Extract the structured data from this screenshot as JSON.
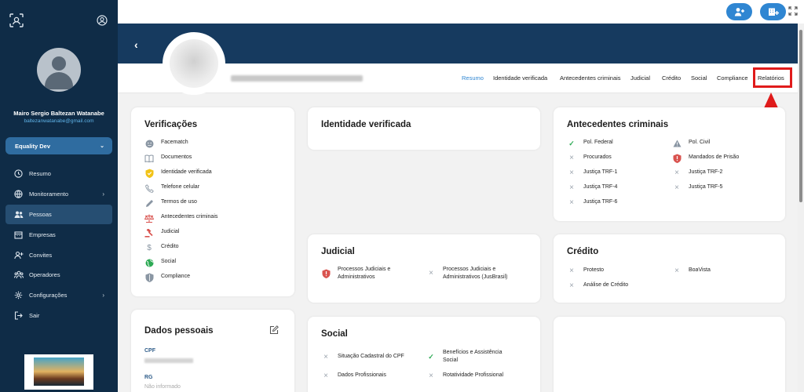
{
  "sidebar": {
    "user_name": "Mairo Sergio Baltezan Watanabe",
    "user_email": "baltezanwatanabe@gmail.com",
    "org": "Equality Dev",
    "nav": [
      {
        "label": "Resumo",
        "icon": "clock-icon",
        "arrow": ""
      },
      {
        "label": "Monitoramento",
        "icon": "globe-icon",
        "arrow": "›"
      },
      {
        "label": "Pessoas",
        "icon": "people-icon",
        "arrow": ""
      },
      {
        "label": "Empresas",
        "icon": "building-icon",
        "arrow": ""
      },
      {
        "label": "Convites",
        "icon": "invite-icon",
        "arrow": ""
      },
      {
        "label": "Operadores",
        "icon": "operators-icon",
        "arrow": ""
      },
      {
        "label": "Configurações",
        "icon": "gear-icon",
        "arrow": "›"
      },
      {
        "label": "Sair",
        "icon": "logout-icon",
        "arrow": ""
      }
    ]
  },
  "tabs": [
    {
      "label": "Resumo",
      "active": true
    },
    {
      "label": "Identidade verificada"
    },
    {
      "label": "Antecedentes criminais"
    },
    {
      "label": "Judicial"
    },
    {
      "label": "Crédito"
    },
    {
      "label": "Social"
    },
    {
      "label": "Compliance"
    },
    {
      "label": "Relatórios"
    }
  ],
  "verificacoes": {
    "title": "Verificações",
    "items": [
      {
        "label": "Facematch",
        "icon": "face-icon"
      },
      {
        "label": "Documentos",
        "icon": "document-icon"
      },
      {
        "label": "Identidade verificada",
        "icon": "shield-check-icon"
      },
      {
        "label": "Telefone celular",
        "icon": "phone-icon"
      },
      {
        "label": "Termos de uso",
        "icon": "pen-icon"
      },
      {
        "label": "Antecedentes criminais",
        "icon": "scales-icon"
      },
      {
        "label": "Judicial",
        "icon": "gavel-icon"
      },
      {
        "label": "Crédito",
        "icon": "dollar-icon"
      },
      {
        "label": "Social",
        "icon": "globe-icon"
      },
      {
        "label": "Compliance",
        "icon": "shield-icon"
      }
    ]
  },
  "identidade": {
    "title": "Identidade verificada"
  },
  "antecedentes": {
    "title": "Antecedentes criminais",
    "left": [
      {
        "label": "Pol. Federal",
        "status": "check"
      },
      {
        "label": "Procurados",
        "status": "x"
      },
      {
        "label": "Justiça TRF-1",
        "status": "x"
      },
      {
        "label": "Justiça TRF-4",
        "status": "x"
      },
      {
        "label": "Justiça TRF-6",
        "status": "x"
      }
    ],
    "right": [
      {
        "label": "Pol. Civil",
        "status": "warning"
      },
      {
        "label": "Mandados de Prisão",
        "status": "alert"
      },
      {
        "label": "Justiça TRF-2",
        "status": "x"
      },
      {
        "label": "Justiça TRF-5",
        "status": "x"
      }
    ]
  },
  "judicial": {
    "title": "Judicial",
    "items": [
      {
        "label1": "Processos Judiciais e",
        "label2": "Administrativos",
        "status": "alert"
      },
      {
        "label1": "Processos Judiciais e",
        "label2": "Administrativos (JusBrasil)",
        "status": "x"
      }
    ]
  },
  "credito": {
    "title": "Crédito",
    "items": [
      {
        "label": "Protesto",
        "status": "x"
      },
      {
        "label": "BoaVista",
        "status": "x"
      },
      {
        "label": "Análise de Crédito",
        "status": "x"
      }
    ]
  },
  "social": {
    "title": "Social",
    "items": [
      {
        "label1": "Situação Cadastral do CPF",
        "label2": "",
        "status": "x"
      },
      {
        "label1": "Benefícios e Assistência",
        "label2": "Social",
        "status": "check"
      },
      {
        "label1": "Dados Profissionais",
        "label2": "",
        "status": "x"
      },
      {
        "label1": "Rotatividade Profissional",
        "label2": "",
        "status": "x"
      }
    ]
  },
  "dados": {
    "title": "Dados pessoais",
    "cpf_label": "CPF",
    "rg_label": "RG",
    "rg_value": "Não informado"
  },
  "colors": {
    "sidebar": "#0f2c47",
    "accent": "#2f86d2",
    "highlight": "#e01b1b"
  }
}
